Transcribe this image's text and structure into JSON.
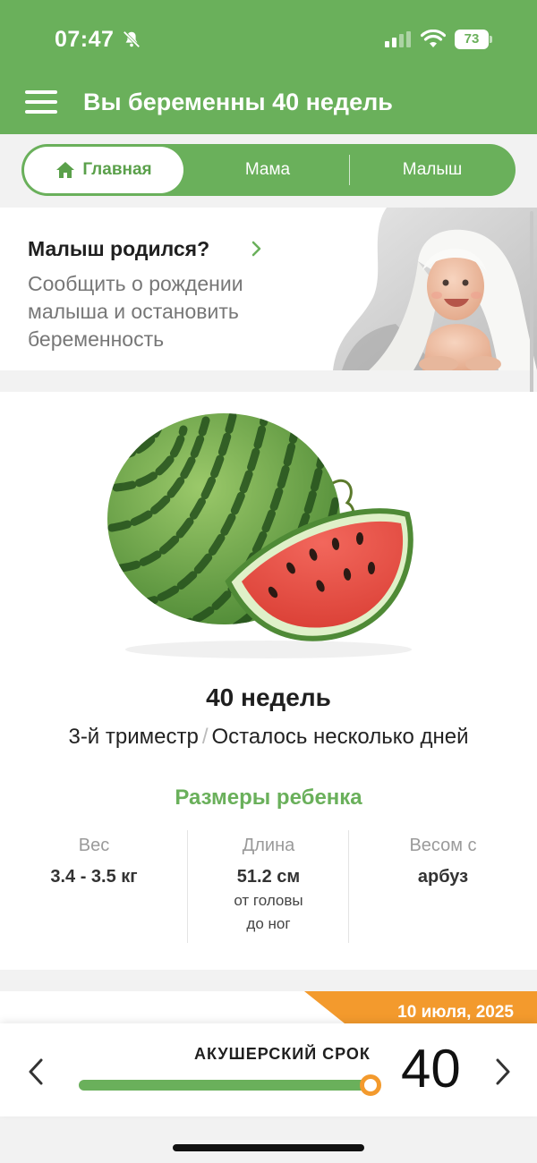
{
  "status_bar": {
    "time": "07:47",
    "battery": "73",
    "icons": [
      "bell-off-icon",
      "signal-icon",
      "wifi-icon",
      "battery-icon"
    ]
  },
  "header": {
    "title": "Вы беременны 40 недель",
    "menu_icon": "hamburger-menu-icon"
  },
  "tabs": [
    {
      "label": "Главная",
      "icon": "home-icon",
      "active": true
    },
    {
      "label": "Мама",
      "active": false
    },
    {
      "label": "Малыш",
      "active": false
    }
  ],
  "banner": {
    "title": "Малыш родился?",
    "description": "Сообщить о рождении малыша и остановить беременность",
    "chevron_icon": "chevron-right-icon"
  },
  "week": {
    "title": "40 недель",
    "trimester": "3-й триместр",
    "separator": "/",
    "remaining": "Осталось несколько дней",
    "fruit_icon": "watermelon-icon"
  },
  "sizes": {
    "title": "Размеры ребенка",
    "weight": {
      "label": "Вес",
      "value": "3.4 - 3.5 кг"
    },
    "length": {
      "label": "Длина",
      "value": "51.2 см",
      "note_line1": "от головы",
      "note_line2": "до ног"
    },
    "compare": {
      "label": "Весом с",
      "value": "арбуз"
    }
  },
  "next_card": {
    "date": "10 июля, 2025"
  },
  "week_selector": {
    "label": "АКУШЕРСКИЙ СРОК",
    "week": "40",
    "progress_fraction": 1.0,
    "prev_icon": "chevron-left-icon",
    "next_icon": "chevron-right-icon"
  },
  "colors": {
    "brand_green": "#6ab05b",
    "accent_orange": "#f39a2d",
    "background": "#f2f2f2"
  }
}
